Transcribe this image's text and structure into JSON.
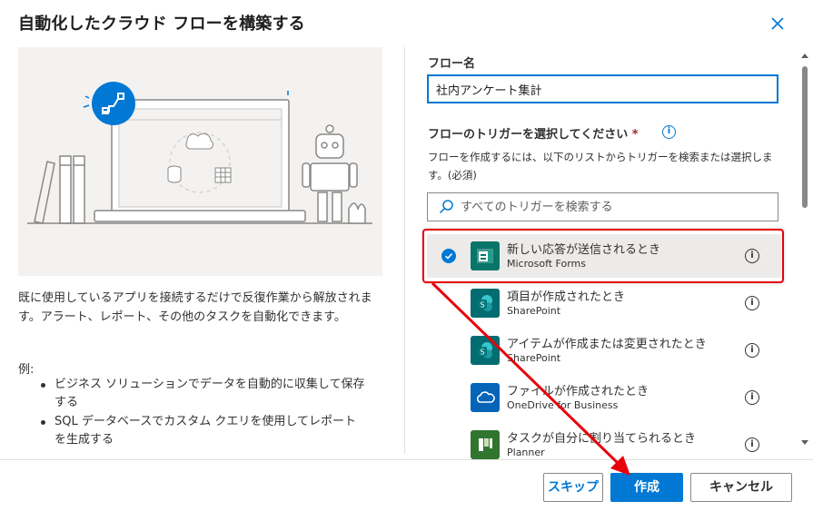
{
  "dialog": {
    "title": "自動化したクラウド フローを構築する",
    "description": "既に使用しているアプリを接続するだけで反復作業から解放されます。アラート、レポート、その他のタスクを自動化できます。",
    "example_label": "例:",
    "examples": [
      "ビジネス ソリューションでデータを自動的に収集して保存する",
      "SQL データベースでカスタム クエリを使用してレポートを生成する"
    ]
  },
  "form": {
    "flow_name_label": "フロー名",
    "flow_name_value": "社内アンケート集計",
    "trigger_label": "フローのトリガーを選択してください",
    "required_mark": "*",
    "help_text": "フローを作成するには、以下のリストからトリガーを検索または選択します。(必須)",
    "search_placeholder": "すべてのトリガーを検索する"
  },
  "triggers": [
    {
      "name": "新しい応答が送信されるとき",
      "connector": "Microsoft Forms",
      "icon": "forms-icon",
      "color": "#077568",
      "selected": true
    },
    {
      "name": "項目が作成されたとき",
      "connector": "SharePoint",
      "icon": "sharepoint-icon",
      "color": "#036c70",
      "selected": false
    },
    {
      "name": "アイテムが作成または変更されたとき",
      "connector": "SharePoint",
      "icon": "sharepoint-icon",
      "color": "#036c70",
      "selected": false
    },
    {
      "name": "ファイルが作成されたとき",
      "connector": "OneDrive for Business",
      "icon": "onedrive-icon",
      "color": "#0364b8",
      "selected": false
    },
    {
      "name": "タスクが自分に割り当てられるとき",
      "connector": "Planner",
      "icon": "planner-icon",
      "color": "#31752f",
      "selected": false
    }
  ],
  "buttons": {
    "skip": "スキップ",
    "create": "作成",
    "cancel": "キャンセル"
  },
  "colors": {
    "accent": "#0078d4",
    "annotation": "#e8000b"
  }
}
